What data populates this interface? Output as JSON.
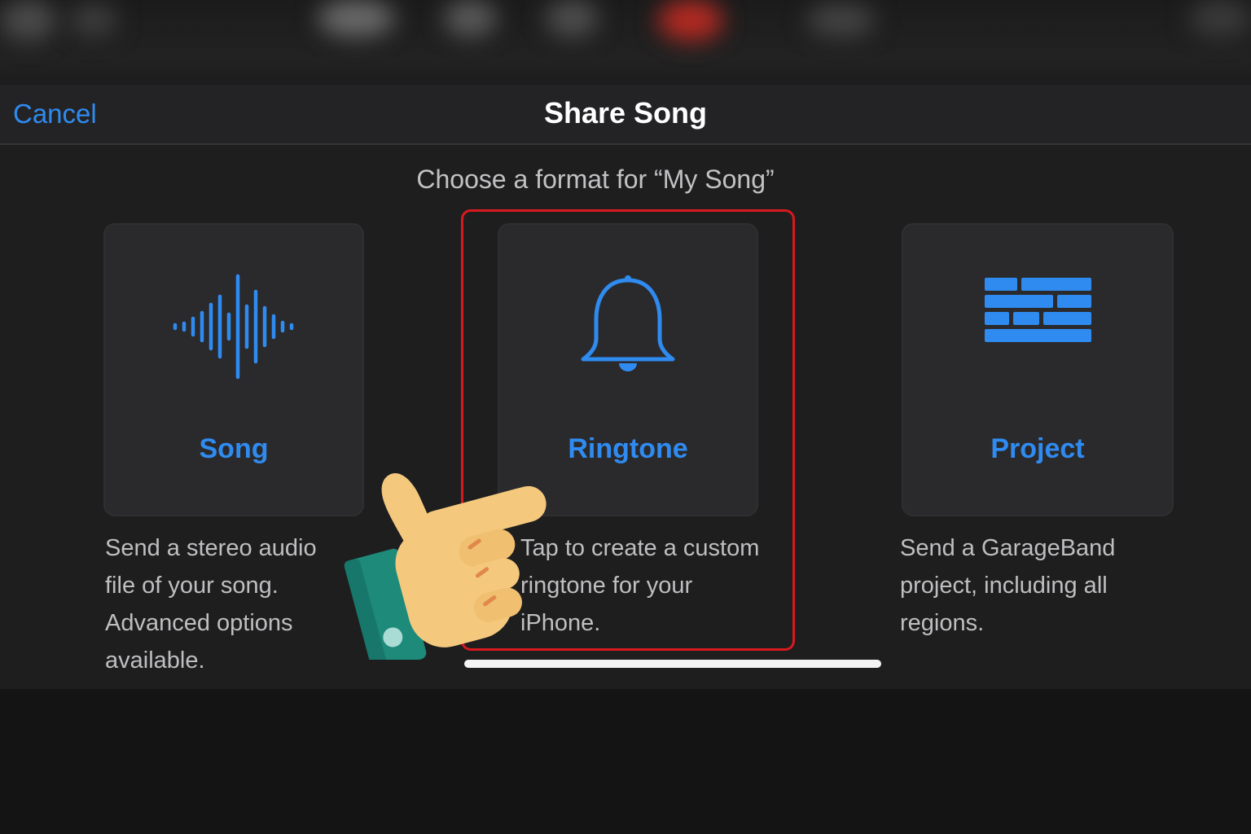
{
  "header": {
    "cancel_label": "Cancel",
    "title": "Share Song"
  },
  "subtitle": "Choose a format for “My Song”",
  "options": [
    {
      "label": "Song",
      "icon": "waveform-icon",
      "description_lines": [
        "Send a stereo audio",
        "file of your song.",
        "Advanced options",
        "available."
      ]
    },
    {
      "label": "Ringtone",
      "icon": "bell-icon",
      "description_lines": [
        "Tap to create a custom",
        "ringtone for your",
        "iPhone."
      ],
      "highlighted": true
    },
    {
      "label": "Project",
      "icon": "tracks-grid-icon",
      "description_lines": [
        "Send a GarageBand",
        "project, including all",
        "regions."
      ]
    }
  ],
  "overlay": {
    "pointer": "pointing-hand-icon",
    "highlight_color": "#d8191f"
  },
  "colors": {
    "accent": "#2f8bf0",
    "background": "#1e1e1f",
    "card": "#2a2a2c",
    "text": "#bfbfc1"
  }
}
